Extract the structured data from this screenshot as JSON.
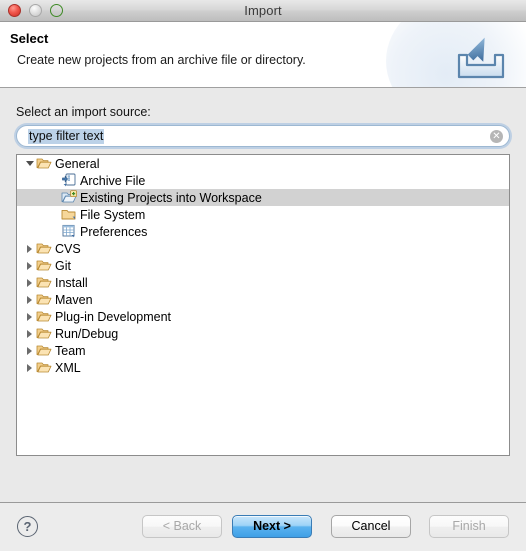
{
  "window": {
    "title": "Import",
    "controls": {
      "close": "close-button",
      "minimize": "minimize-button",
      "zoom": "zoom-button"
    }
  },
  "header": {
    "title": "Select",
    "description": "Create new projects from an archive file or directory.",
    "icon": "import-inbox-icon"
  },
  "source": {
    "label": "Select an import source:"
  },
  "filter": {
    "value": "type filter text",
    "placeholder": "type filter text",
    "clear_label": "✕"
  },
  "tree": {
    "rows": [
      {
        "label": "General",
        "level": 0,
        "state": "expanded",
        "icon": "open-folder-icon",
        "selected": false
      },
      {
        "label": "Archive File",
        "level": 1,
        "state": "leaf",
        "icon": "archive-file-icon",
        "selected": false
      },
      {
        "label": "Existing Projects into Workspace",
        "level": 1,
        "state": "leaf",
        "icon": "import-project-icon",
        "selected": true
      },
      {
        "label": "File System",
        "level": 1,
        "state": "leaf",
        "icon": "folder-icon",
        "selected": false
      },
      {
        "label": "Preferences",
        "level": 1,
        "state": "leaf",
        "icon": "preferences-file-icon",
        "selected": false
      },
      {
        "label": "CVS",
        "level": 0,
        "state": "collapsed",
        "icon": "open-folder-icon",
        "selected": false
      },
      {
        "label": "Git",
        "level": 0,
        "state": "collapsed",
        "icon": "open-folder-icon",
        "selected": false
      },
      {
        "label": "Install",
        "level": 0,
        "state": "collapsed",
        "icon": "open-folder-icon",
        "selected": false
      },
      {
        "label": "Maven",
        "level": 0,
        "state": "collapsed",
        "icon": "open-folder-icon",
        "selected": false
      },
      {
        "label": "Plug-in Development",
        "level": 0,
        "state": "collapsed",
        "icon": "open-folder-icon",
        "selected": false
      },
      {
        "label": "Run/Debug",
        "level": 0,
        "state": "collapsed",
        "icon": "open-folder-icon",
        "selected": false
      },
      {
        "label": "Team",
        "level": 0,
        "state": "collapsed",
        "icon": "open-folder-icon",
        "selected": false
      },
      {
        "label": "XML",
        "level": 0,
        "state": "collapsed",
        "icon": "open-folder-icon",
        "selected": false
      }
    ]
  },
  "footer": {
    "help_label": "?",
    "back_label": "< Back",
    "next_label": "Next >",
    "cancel_label": "Cancel",
    "finish_label": "Finish"
  },
  "colors": {
    "default_button": "#5ab2ef",
    "selection": "#d2d2d2",
    "text_selection": "#bcd2e8",
    "folder": "#f0c070"
  }
}
